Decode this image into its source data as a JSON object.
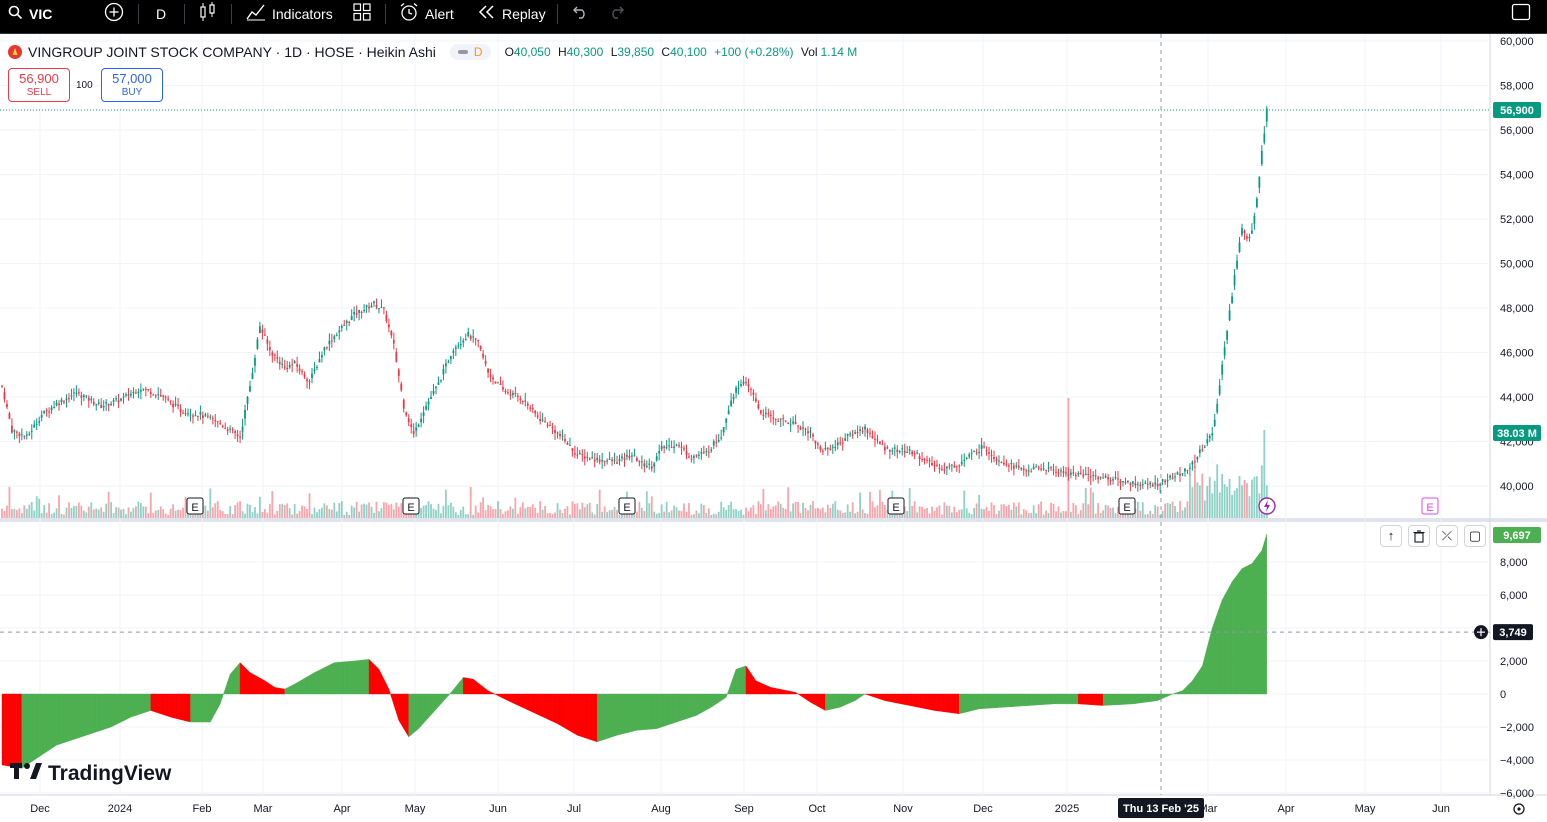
{
  "toolbar": {
    "symbol": "VIC",
    "interval": "D",
    "indicators_label": "Indicators",
    "alert_label": "Alert",
    "replay_label": "Replay"
  },
  "legend": {
    "title": "VINGROUP JOINT STOCK COMPANY · 1D · HOSE · Heikin Ashi",
    "badge": "D",
    "o_label": "O",
    "o": "40,050",
    "h_label": "H",
    "h": "40,300",
    "l_label": "L",
    "l": "39,850",
    "c_label": "C",
    "c": "40,100",
    "change": "+100 (+0.28%)",
    "vol_label": "Vol",
    "vol": "1.14 M"
  },
  "trade": {
    "sell_price": "56,900",
    "sell_label": "SELL",
    "qty": "100",
    "buy_price": "57,000",
    "buy_label": "BUY"
  },
  "watermark": "TradingView",
  "colors": {
    "up": "#089981",
    "down": "#f23645",
    "osc_up": "#4caf50",
    "osc_down": "#ff0000"
  },
  "chart_data": [
    {
      "type": "candlestick",
      "title": "VINGROUP JOINT STOCK COMPANY · 1D · HOSE · Heikin Ashi",
      "ylim": [
        39000,
        60000
      ],
      "y_ticks": [
        "40,000",
        "42,000",
        "44,000",
        "46,000",
        "48,000",
        "50,000",
        "52,000",
        "54,000",
        "56,000",
        "58,000",
        "60,000"
      ],
      "y_tick_values": [
        40000,
        42000,
        44000,
        46000,
        48000,
        50000,
        52000,
        54000,
        56000,
        58000,
        60000
      ],
      "last_price": "56,900",
      "last_price_value": 56900,
      "volume_label": "38.03 M",
      "x_labels": [
        "Dec",
        "2024",
        "Feb",
        "Mar",
        "Apr",
        "May",
        "Jun",
        "Jul",
        "Aug",
        "Sep",
        "Oct",
        "Nov",
        "Dec",
        "2025",
        "Mar",
        "Apr",
        "May",
        "Jun"
      ],
      "crosshair_date": "Thu 13 Feb '25",
      "earnings_marker": "E",
      "price_path": [
        [
          0,
          44500
        ],
        [
          4,
          42500
        ],
        [
          10,
          42200
        ],
        [
          16,
          43200
        ],
        [
          22,
          43700
        ],
        [
          30,
          44200
        ],
        [
          40,
          43600
        ],
        [
          48,
          43900
        ],
        [
          56,
          44400
        ],
        [
          64,
          44100
        ],
        [
          72,
          43400
        ],
        [
          80,
          43200
        ],
        [
          88,
          42800
        ],
        [
          96,
          42200
        ],
        [
          100,
          44500
        ],
        [
          104,
          47200
        ],
        [
          108,
          46100
        ],
        [
          114,
          45300
        ],
        [
          118,
          45500
        ],
        [
          124,
          44700
        ],
        [
          130,
          46200
        ],
        [
          136,
          47000
        ],
        [
          142,
          47700
        ],
        [
          150,
          48200
        ],
        [
          154,
          47900
        ],
        [
          158,
          46300
        ],
        [
          162,
          43600
        ],
        [
          166,
          42300
        ],
        [
          170,
          43400
        ],
        [
          176,
          44600
        ],
        [
          182,
          46200
        ],
        [
          188,
          46800
        ],
        [
          192,
          46400
        ],
        [
          196,
          45100
        ],
        [
          202,
          44300
        ],
        [
          210,
          43900
        ],
        [
          216,
          43100
        ],
        [
          222,
          42600
        ],
        [
          228,
          41900
        ],
        [
          232,
          41400
        ],
        [
          240,
          41200
        ],
        [
          248,
          41100
        ],
        [
          254,
          41400
        ],
        [
          258,
          41000
        ],
        [
          262,
          40900
        ],
        [
          266,
          41700
        ],
        [
          272,
          41900
        ],
        [
          278,
          41300
        ],
        [
          284,
          41500
        ],
        [
          290,
          42300
        ],
        [
          294,
          43900
        ],
        [
          298,
          44700
        ],
        [
          302,
          44300
        ],
        [
          306,
          43300
        ],
        [
          312,
          43000
        ],
        [
          320,
          42800
        ],
        [
          326,
          42400
        ],
        [
          330,
          41600
        ],
        [
          336,
          41800
        ],
        [
          342,
          42300
        ],
        [
          348,
          42600
        ],
        [
          352,
          42100
        ],
        [
          356,
          41700
        ],
        [
          362,
          41600
        ],
        [
          368,
          41500
        ],
        [
          374,
          41000
        ],
        [
          380,
          40800
        ],
        [
          386,
          41000
        ],
        [
          392,
          41500
        ],
        [
          396,
          41800
        ],
        [
          400,
          41300
        ],
        [
          406,
          41000
        ],
        [
          412,
          40700
        ],
        [
          420,
          40800
        ],
        [
          428,
          40600
        ],
        [
          436,
          40500
        ],
        [
          444,
          40400
        ],
        [
          452,
          40200
        ],
        [
          458,
          40100
        ],
        [
          462,
          40050
        ],
        [
          466,
          40100
        ],
        [
          470,
          40300
        ],
        [
          476,
          40600
        ],
        [
          480,
          41000
        ],
        [
          484,
          41700
        ],
        [
          488,
          42400
        ],
        [
          490,
          43800
        ],
        [
          492,
          45400
        ],
        [
          494,
          47000
        ],
        [
          496,
          48600
        ],
        [
          498,
          50200
        ],
        [
          500,
          51600
        ],
        [
          502,
          51000
        ],
        [
          504,
          51500
        ],
        [
          506,
          53000
        ],
        [
          508,
          55000
        ],
        [
          510,
          56900
        ]
      ],
      "price_path_x_unit": "trading day index (0 = early Nov 2023)"
    },
    {
      "type": "area",
      "title": "",
      "ylim": [
        -6000,
        10000
      ],
      "y_ticks": [
        "−6,000",
        "−4,000",
        "−2,000",
        "0",
        "2,000",
        "4,000",
        "6,000",
        "8,000"
      ],
      "y_tick_values": [
        -6000,
        -4000,
        -2000,
        0,
        2000,
        4000,
        6000,
        8000
      ],
      "last_value": "9,697",
      "last_value_num": 9697,
      "crosshair_value": "3,749",
      "crosshair_value_num": 3749,
      "values": [
        [
          0,
          -4300
        ],
        [
          8,
          -4500
        ],
        [
          14,
          -3900
        ],
        [
          22,
          -3100
        ],
        [
          32,
          -2600
        ],
        [
          44,
          -2000
        ],
        [
          52,
          -1400
        ],
        [
          60,
          -1000
        ],
        [
          68,
          -1400
        ],
        [
          76,
          -1700
        ],
        [
          84,
          -1700
        ],
        [
          88,
          -600
        ],
        [
          92,
          1200
        ],
        [
          96,
          1900
        ],
        [
          100,
          1300
        ],
        [
          106,
          800
        ],
        [
          110,
          400
        ],
        [
          114,
          300
        ],
        [
          118,
          600
        ],
        [
          126,
          1300
        ],
        [
          134,
          1900
        ],
        [
          142,
          2000
        ],
        [
          148,
          2100
        ],
        [
          152,
          1500
        ],
        [
          156,
          300
        ],
        [
          160,
          -1600
        ],
        [
          164,
          -2600
        ],
        [
          168,
          -2100
        ],
        [
          174,
          -1100
        ],
        [
          180,
          -100
        ],
        [
          186,
          1000
        ],
        [
          190,
          900
        ],
        [
          196,
          200
        ],
        [
          204,
          -400
        ],
        [
          214,
          -1100
        ],
        [
          224,
          -1800
        ],
        [
          232,
          -2500
        ],
        [
          240,
          -2900
        ],
        [
          248,
          -2500
        ],
        [
          256,
          -2200
        ],
        [
          264,
          -2100
        ],
        [
          272,
          -1700
        ],
        [
          280,
          -1300
        ],
        [
          286,
          -800
        ],
        [
          292,
          -200
        ],
        [
          296,
          1500
        ],
        [
          300,
          1700
        ],
        [
          304,
          800
        ],
        [
          310,
          400
        ],
        [
          320,
          100
        ],
        [
          326,
          -500
        ],
        [
          332,
          -1000
        ],
        [
          338,
          -800
        ],
        [
          344,
          -400
        ],
        [
          348,
          0
        ],
        [
          356,
          -400
        ],
        [
          366,
          -700
        ],
        [
          376,
          -1000
        ],
        [
          386,
          -1200
        ],
        [
          394,
          -900
        ],
        [
          404,
          -800
        ],
        [
          414,
          -700
        ],
        [
          424,
          -600
        ],
        [
          434,
          -600
        ],
        [
          444,
          -700
        ],
        [
          456,
          -600
        ],
        [
          466,
          -400
        ],
        [
          472,
          0
        ],
        [
          476,
          200
        ],
        [
          480,
          800
        ],
        [
          484,
          1700
        ],
        [
          488,
          4000
        ],
        [
          492,
          5700
        ],
        [
          496,
          6800
        ],
        [
          500,
          7600
        ],
        [
          504,
          7900
        ],
        [
          508,
          8700
        ],
        [
          510,
          9697
        ]
      ]
    }
  ]
}
